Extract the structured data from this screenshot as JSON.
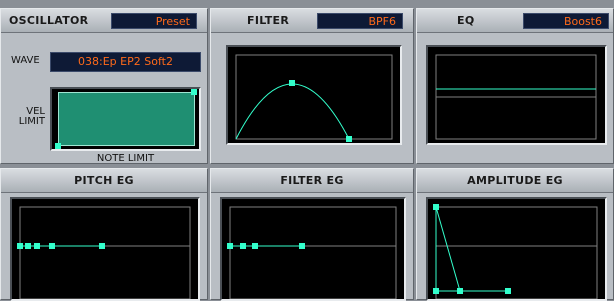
{
  "oscillator": {
    "title": "OSCILLATOR",
    "preset": "Preset",
    "wave_label": "WAVE",
    "wave_value": "038:Ep EP2 Soft2",
    "vel_label": "VEL LIMIT",
    "note_label": "NOTE LIMIT"
  },
  "filter": {
    "title": "FILTER",
    "preset": "BPF6"
  },
  "eq": {
    "title": "EQ",
    "preset": "Boost6"
  },
  "pitch_eg": {
    "title": "PITCH EG"
  },
  "filter_eg": {
    "title": "FILTER EG"
  },
  "amplitude_eg": {
    "title": "AMPLITUDE EG"
  },
  "colors": {
    "panel": "#b9bec4",
    "display_bg": "#000000",
    "curve": "#33ffcc",
    "preset_text": "#ff6a1a",
    "preset_bg": "#0e1a36"
  }
}
